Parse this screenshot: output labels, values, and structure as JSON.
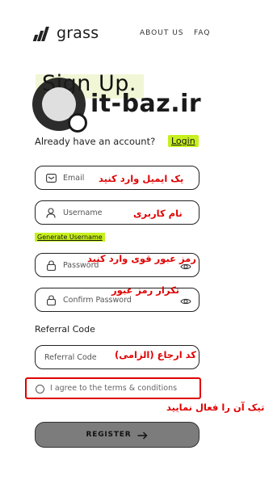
{
  "header": {
    "logo_text": "grass",
    "nav": [
      "ABOUT US",
      "FAQ"
    ]
  },
  "heading": "Sign Up.",
  "watermark": "it-baz.ir",
  "account_prompt": "Already have an account?",
  "login_label": "Login",
  "fields": {
    "email": {
      "placeholder": "Email",
      "annotation": "یک ایمیل وارد کنید"
    },
    "username": {
      "placeholder": "Username",
      "annotation": "نام کاربری"
    },
    "password": {
      "placeholder": "Password",
      "annotation": "رمز عبور قوی وارد کنید"
    },
    "confirm_password": {
      "placeholder": "Confirm Password",
      "annotation": "تکرار رمز عبور"
    },
    "referral": {
      "placeholder": "Referral Code",
      "annotation": "کد ارجاع (الزامی)"
    }
  },
  "generate_username_label": "Generate Username",
  "referral_label": "Referral Code",
  "terms": {
    "label": "I agree to the terms & conditions",
    "checked": false,
    "annotation": "تیک آن را فعال نمایید"
  },
  "register_label": "REGISTER",
  "colors": {
    "accent": "#c7f01e",
    "annotation": "#e00000",
    "button": "#7c7c7c"
  },
  "icons": {
    "email": "envelope-icon",
    "username": "user-icon",
    "password": "lock-icon",
    "confirm_password": "lock-icon",
    "password_eye": "eye-icon",
    "register_arrow": "arrow-right-icon"
  }
}
